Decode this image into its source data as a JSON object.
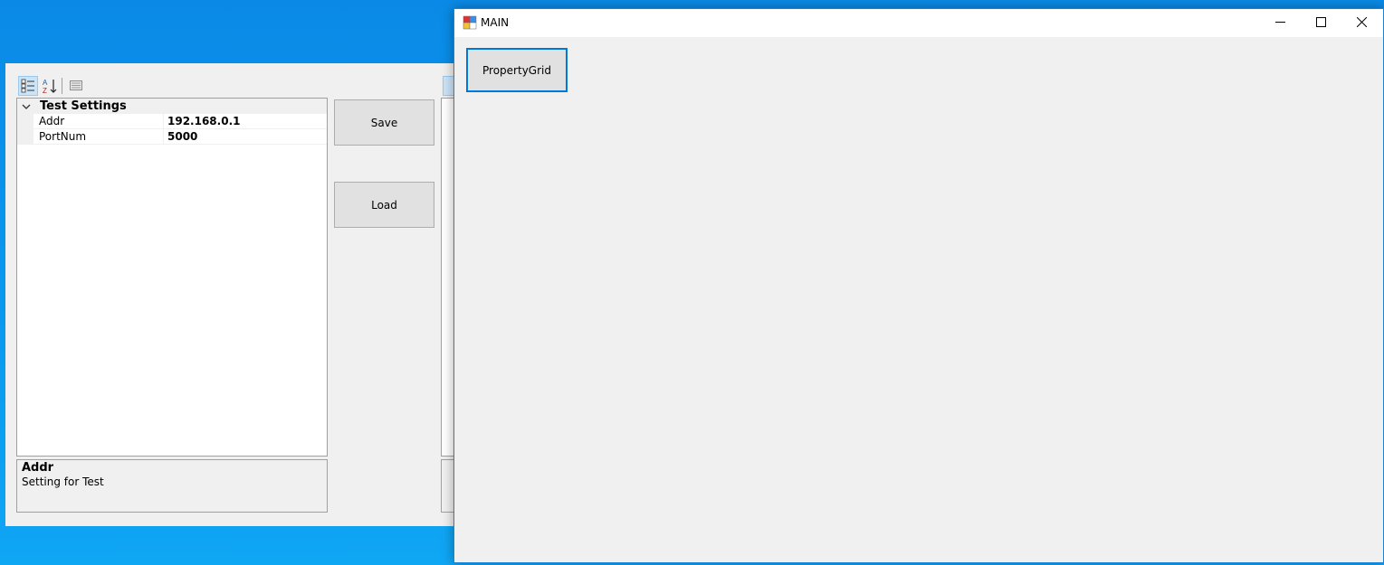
{
  "back_window": {
    "toolbar": {
      "categorized_icon": "categorized-icon",
      "alphabetical_icon": "sort-alphabetical-icon",
      "property_pages_icon": "property-pages-icon"
    },
    "property_grid": {
      "category": "Test Settings",
      "properties": [
        {
          "name": "Addr",
          "value": "192.168.0.1"
        },
        {
          "name": "PortNum",
          "value": "5000"
        }
      ]
    },
    "help_panel": {
      "title": "Addr",
      "description": "Setting for Test"
    },
    "buttons": {
      "save_label": "Save",
      "load_label": "Load"
    }
  },
  "main_window": {
    "title": "MAIN",
    "caption_icons": [
      "minimize-icon",
      "maximize-icon",
      "close-icon"
    ],
    "propertygrid_button_label": "PropertyGrid"
  },
  "colors": {
    "desktop": "#0a97ee",
    "window_border": "#1883d7",
    "focus_border": "#0078d7",
    "control_face": "#f0f0f0"
  }
}
